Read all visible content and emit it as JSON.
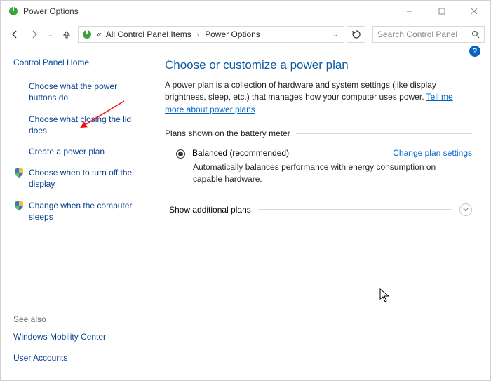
{
  "window": {
    "title": "Power Options"
  },
  "breadcrumb": {
    "prefix": "«",
    "item1": "All Control Panel Items",
    "item2": "Power Options"
  },
  "search": {
    "placeholder": "Search Control Panel"
  },
  "sidebar": {
    "home": "Control Panel Home",
    "items": [
      "Choose what the power buttons do",
      "Choose what closing the lid does",
      "Create a power plan",
      "Choose when to turn off the display",
      "Change when the computer sleeps"
    ],
    "see_also_header": "See also",
    "see_also": [
      "Windows Mobility Center",
      "User Accounts"
    ]
  },
  "main": {
    "title": "Choose or customize a power plan",
    "description_pre": "A power plan is a collection of hardware and system settings (like display brightness, sleep, etc.) that manages how your computer uses power. ",
    "description_link": "Tell me more about power plans",
    "plans_header": "Plans shown on the battery meter",
    "plan_balanced_label": "Balanced (recommended)",
    "change_plan_settings": "Change plan settings",
    "plan_balanced_desc": "Automatically balances performance with energy consumption on capable hardware.",
    "show_additional": "Show additional plans"
  }
}
